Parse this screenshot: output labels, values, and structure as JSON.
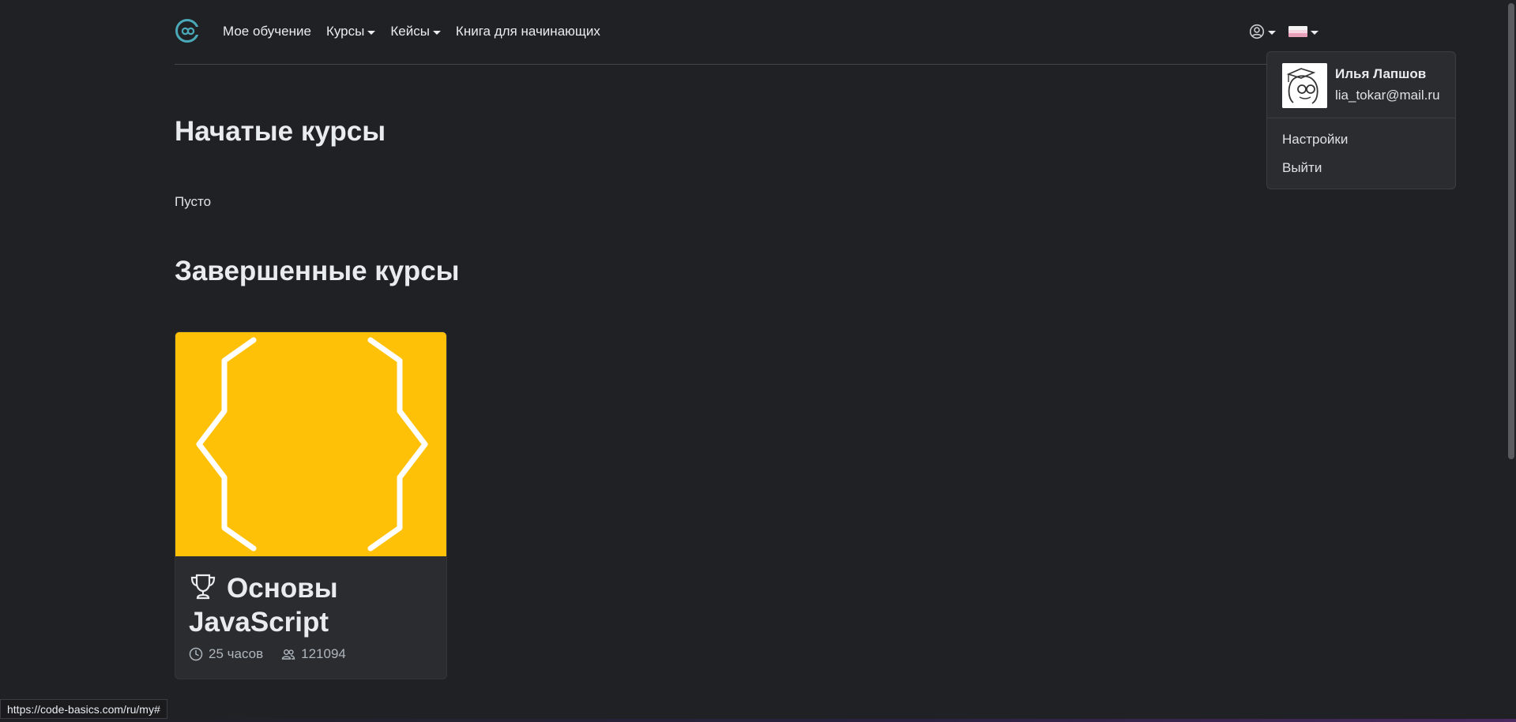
{
  "nav": {
    "links": [
      {
        "label": "Мое обучение"
      },
      {
        "label": "Курсы"
      },
      {
        "label": "Кейсы"
      },
      {
        "label": "Книга для начинающих"
      }
    ]
  },
  "user_menu": {
    "name": "Илья Лапшов",
    "email": "lia_tokar@mail.ru",
    "items": [
      {
        "label": "Настройки"
      },
      {
        "label": "Выйти"
      }
    ]
  },
  "sections": {
    "started_title": "Начатые курсы",
    "started_empty": "Пусто",
    "completed_title": "Завершенные курсы"
  },
  "course_card": {
    "title": "Основы JavaScript",
    "duration": "25 часов",
    "students": "121094",
    "image_color": "#ffc107"
  },
  "status_bar": {
    "url": "https://code-basics.com/ru/my#"
  },
  "colors": {
    "background": "#202124",
    "accent": "#4aa9b8",
    "card_bg": "#2b2c2f"
  },
  "icons": {
    "logo": "code-basics-logo-icon",
    "user": "user-circle-icon",
    "language": "russian-flag-icon",
    "trophy": "trophy-icon",
    "clock": "clock-icon",
    "people": "people-icon"
  }
}
